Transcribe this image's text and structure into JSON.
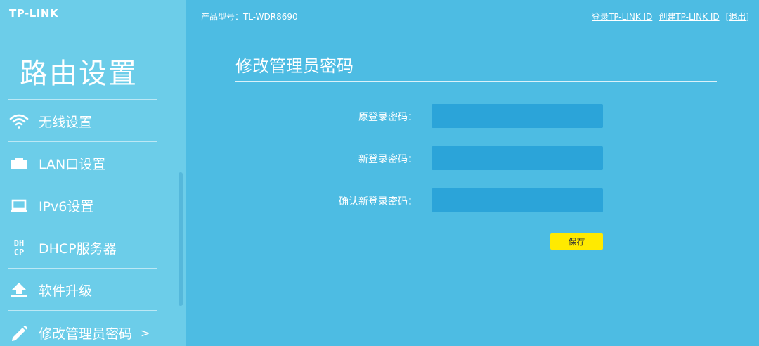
{
  "brand": {
    "logo": "TP-LINK"
  },
  "sidebar": {
    "title": "路由设置",
    "items": [
      {
        "label": "无线设置",
        "icon": "wifi-icon"
      },
      {
        "label": "LAN口设置",
        "icon": "lan-port-icon"
      },
      {
        "label": "IPv6设置",
        "icon": "laptop-icon"
      },
      {
        "label": "DHCP服务器",
        "icon": "dhcp-icon",
        "icon_text": "DHCP"
      },
      {
        "label": "软件升级",
        "icon": "upload-icon"
      },
      {
        "label": "修改管理员密码",
        "icon": "pencil-icon",
        "active": true,
        "chevron": ">"
      }
    ]
  },
  "header": {
    "model": "产品型号：TL-WDR8690",
    "links": [
      "登录TP-LINK ID",
      "创建TP-LINK ID",
      "[退出]"
    ]
  },
  "main": {
    "title": "修改管理员密码",
    "form": {
      "fields": [
        {
          "label": "原登录密码：",
          "value": ""
        },
        {
          "label": "新登录密码：",
          "value": ""
        },
        {
          "label": "确认新登录密码：",
          "value": ""
        }
      ],
      "save_label": "保存"
    }
  },
  "colors": {
    "main_bg": "#4dbce3",
    "sidebar_bg": "#6ccde9",
    "input_bg": "#2ba4d9",
    "save_button": "#ffea00"
  }
}
